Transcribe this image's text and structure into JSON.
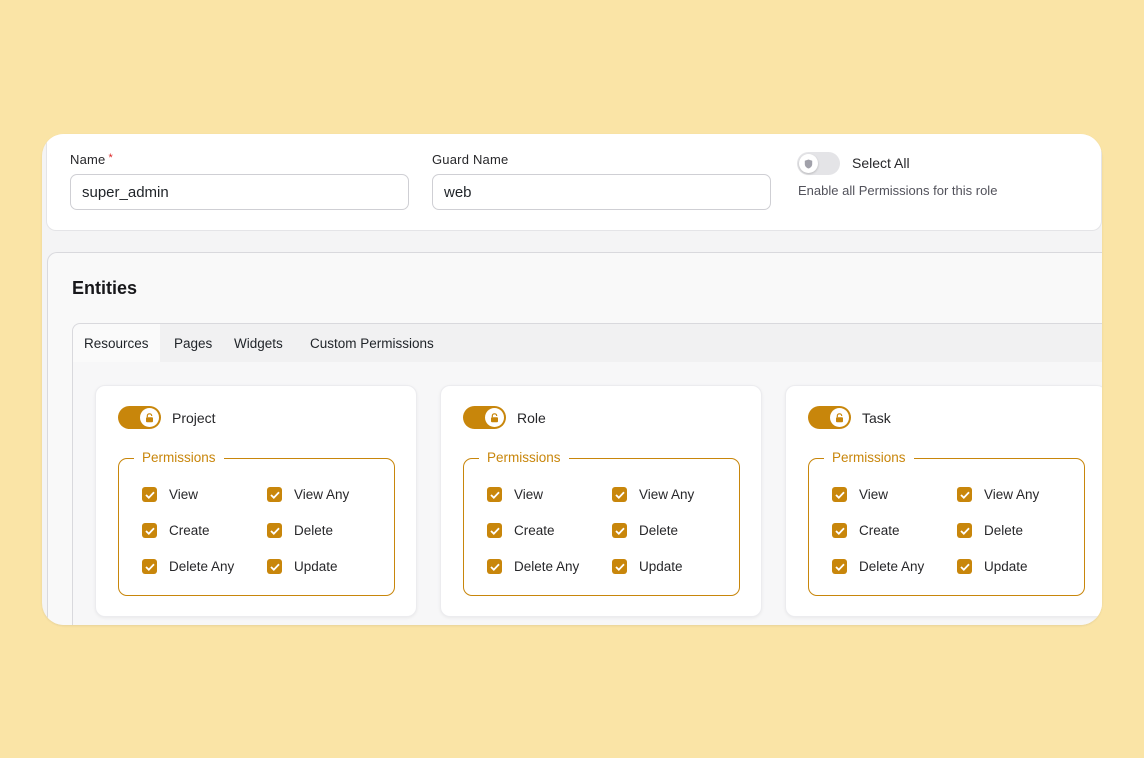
{
  "form": {
    "name_label": "Name",
    "name_required": "*",
    "name_value": "super_admin",
    "guard_label": "Guard Name",
    "guard_value": "web",
    "select_all_label": "Select All",
    "select_all_hint": "Enable all Permissions for this role"
  },
  "entities": {
    "title": "Entities",
    "tabs": [
      {
        "label": "Resources",
        "active": true
      },
      {
        "label": "Pages"
      },
      {
        "label": "Widgets"
      },
      {
        "label": "Custom Permissions"
      }
    ],
    "resources": [
      {
        "name": "Project",
        "enabled": true,
        "permissions_legend": "Permissions",
        "permissions": [
          "View",
          "View Any",
          "Create",
          "Delete",
          "Delete Any",
          "Update"
        ]
      },
      {
        "name": "Role",
        "enabled": true,
        "permissions_legend": "Permissions",
        "permissions": [
          "View",
          "View Any",
          "Create",
          "Delete",
          "Delete Any",
          "Update"
        ]
      },
      {
        "name": "Task",
        "enabled": true,
        "permissions_legend": "Permissions",
        "permissions": [
          "View",
          "View Any",
          "Create",
          "Delete",
          "Delete Any",
          "Update"
        ]
      }
    ]
  },
  "colors": {
    "accent": "#c8860b",
    "background": "#fae4a6"
  }
}
